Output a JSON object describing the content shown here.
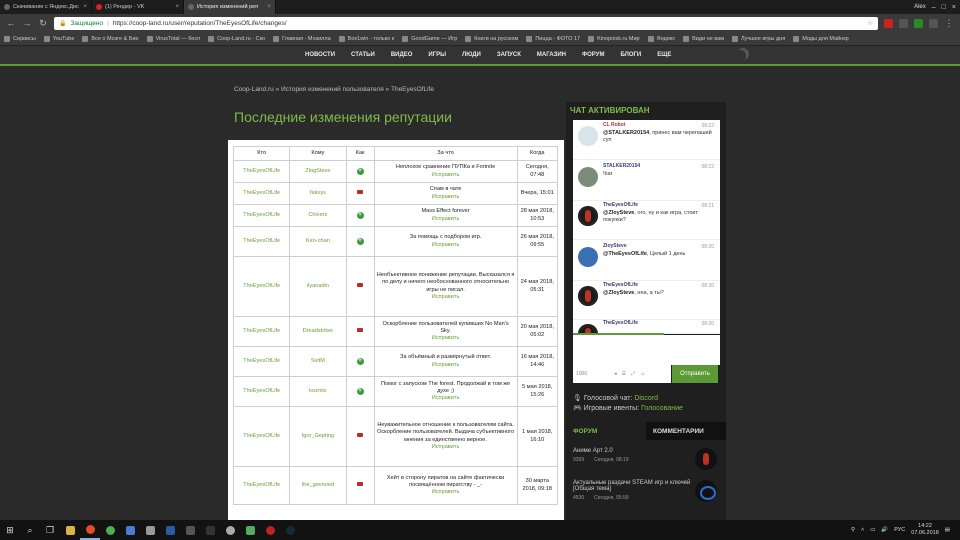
{
  "browser": {
    "tabs": [
      {
        "title": "Скачивание с Яндекс.Дис",
        "favicon": "gray"
      },
      {
        "title": "(1) Рендер - VK",
        "favicon": "red"
      },
      {
        "title": "История изменений реп",
        "favicon": "gray",
        "active": true
      }
    ],
    "profile": "Alex",
    "secure_label": "Защищено",
    "url": "https://coop-land.ru/user/reputation/TheEyesOfLife/changes/",
    "bookmarks": [
      "Сервисы",
      "YouTube",
      "Все о Мозге & Био",
      "VirusTotal — бесп",
      "Coop-Land.ru - Ско",
      "Главная - Мозилла",
      "Box1win - только к",
      "GoodGame — Игр",
      "Книги на русском",
      "Пицца - ФОТО 17",
      "Kinopoisk.ru Мир",
      "Яндекс",
      "Види не вам",
      "Лучшее игры дня",
      "Моды для Майнкр"
    ]
  },
  "site": {
    "nav": [
      "Новости",
      "Статьи",
      "Видео",
      "Игры",
      "Люди",
      "Запуск",
      "Магазин",
      "Форум",
      "Блоги",
      "Еще"
    ]
  },
  "breadcrumb": {
    "home": "Coop-Land.ru",
    "sep": "»",
    "section": "История изменений пользователя",
    "current": "TheEyesOfLife"
  },
  "page_title": "Последние изменения репутации",
  "table": {
    "headers": [
      "Кто",
      "Кому",
      "Как",
      "За что",
      "Когда"
    ],
    "fix_label": "Исправить",
    "rows": [
      {
        "who": "TheEyesOfLife",
        "to": "ZlogSteve",
        "sign": "plus",
        "reason": "Неплохое сравнение ПУПКа и Fortnite",
        "when": "Сегодня, 07:48"
      },
      {
        "who": "TheEyesOfLife",
        "to": "faksys",
        "sign": "minus",
        "reason": "Спам в чате",
        "when": "Вчера, 15:01"
      },
      {
        "who": "TheEyesOfLife",
        "to": "Chivers",
        "sign": "plus",
        "reason": "Mass Effect forever",
        "when": "28 мая 2018, 10:53"
      },
      {
        "who": "TheEyesOfLife",
        "to": "Ken-chan",
        "sign": "plus",
        "reason": "За помощь с подбором игр.",
        "when": "26 мая 2018, 09:55"
      },
      {
        "who": "TheEyesOfLife",
        "to": "ilyanadin",
        "sign": "minus",
        "reason": "Необъективное понижение репутации. Высказался я по делу и ничего необоснованного относительно игры не писал.",
        "when": "24 мая 2018, 05:31"
      },
      {
        "who": "TheEyesOfLife",
        "to": "Dreadstriker",
        "sign": "minus",
        "reason": "Оскорбление пользователей купивших No Man's Sky.",
        "when": "20 мая 2018, 05:02"
      },
      {
        "who": "TheEyesOfLife",
        "to": "SvitM",
        "sign": "plus",
        "reason": "За объёмный и развёрнутый ответ.",
        "when": "16 мая 2018, 14:46"
      },
      {
        "who": "TheEyesOfLife",
        "to": "kozmix",
        "sign": "plus",
        "reason": "Помог с запуском The forest. Продолжай в том же духе ;)",
        "when": "5 мая 2018, 15:26"
      },
      {
        "who": "TheEyesOfLife",
        "to": "Igor_Gepting",
        "sign": "minus",
        "reason": "Неуважительное отношение к пользователям сайта. Оскорбление пользователей. Выдача субъективного мнения за единственно верное.",
        "when": "1 мая 2018, 16:10"
      },
      {
        "who": "TheEyesOfLife",
        "to": "the_govnoed",
        "sign": "minus",
        "reason": "Хейт в сторону пиратов на сайте фактически посвящённом пиратству - _-",
        "when": "30 марта 2018, 09:18"
      }
    ]
  },
  "chat": {
    "title": "Чат активирован",
    "messages": [
      {
        "name": "CL Robot",
        "time": "08:22",
        "mention": "@STALKER20154",
        "text": ", принес вам черепаший суп",
        "avatar": "robot"
      },
      {
        "name": "STALKER20154",
        "time": "08:22",
        "mention": "",
        "text": "!bar",
        "avatar": "photo"
      },
      {
        "name": "TheEyesOfLife",
        "time": "08:21",
        "mention": "@ZloySteve",
        "text": ", ого, ну и как игра, стоит покупки?",
        "avatar": "dark"
      },
      {
        "name": "ZloySteve",
        "time": "08:20",
        "mention": "@TheEyesOfLife",
        "text": ", Целый 1 день",
        "avatar": "blue"
      },
      {
        "name": "TheEyesOfLife",
        "time": "08:20",
        "mention": "@ZloySteve",
        "text": ", неа, а ты?",
        "avatar": "dark"
      },
      {
        "name": "TheEyesOfLife",
        "time": "08:20",
        "mention": "",
        "text": "",
        "avatar": "dark"
      }
    ],
    "char_count": "1000",
    "send_label": "Отправить",
    "voice_label": "Голосовой чат:",
    "voice_link": "Discord",
    "events_label": "Игровые ивенты:",
    "events_link": "Голосование"
  },
  "forum": {
    "tabs": [
      "Форум",
      "Комментарии"
    ],
    "items": [
      {
        "title": "Аниме Арт 2.0",
        "count": "9399",
        "time": "Сегодня, 08:19",
        "fav": "red"
      },
      {
        "title": "Актуальные раздачи STEAM игр и ключей [Общая тема]",
        "count": "4530",
        "time": "Сегодня, 05:59",
        "fav": "blue"
      }
    ]
  },
  "taskbar": {
    "lang": "РУС",
    "time": "14:22",
    "date": "07.06.2018"
  }
}
